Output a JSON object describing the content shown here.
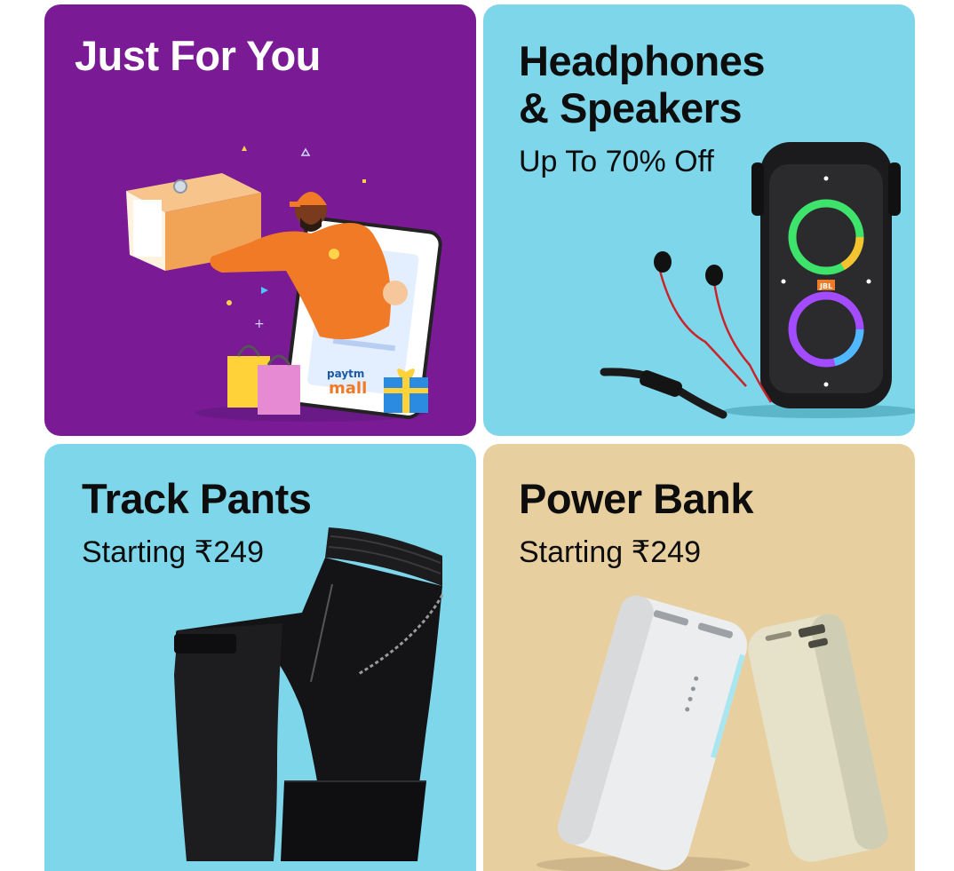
{
  "cards": [
    {
      "title": "Just For You",
      "subtitle": "",
      "art": "paytm-mall-delivery-illustration",
      "bg": "#7a1a94"
    },
    {
      "title_line1": "Headphones",
      "title_line2": "& Speakers",
      "subtitle": "Up To 70% Off",
      "art": "speaker-and-earphones-image",
      "bg": "#7dd6ea"
    },
    {
      "title": "Track Pants",
      "subtitle": "Starting ₹249",
      "art": "track-pants-image",
      "bg": "#7dd6ea"
    },
    {
      "title": "Power Bank",
      "subtitle": "Starting ₹249",
      "art": "power-bank-image",
      "bg": "#e8cf9f"
    }
  ],
  "illustration": {
    "logo_top": "paytm",
    "logo_bottom": "mall"
  },
  "speaker": {
    "brand": "JBL"
  }
}
